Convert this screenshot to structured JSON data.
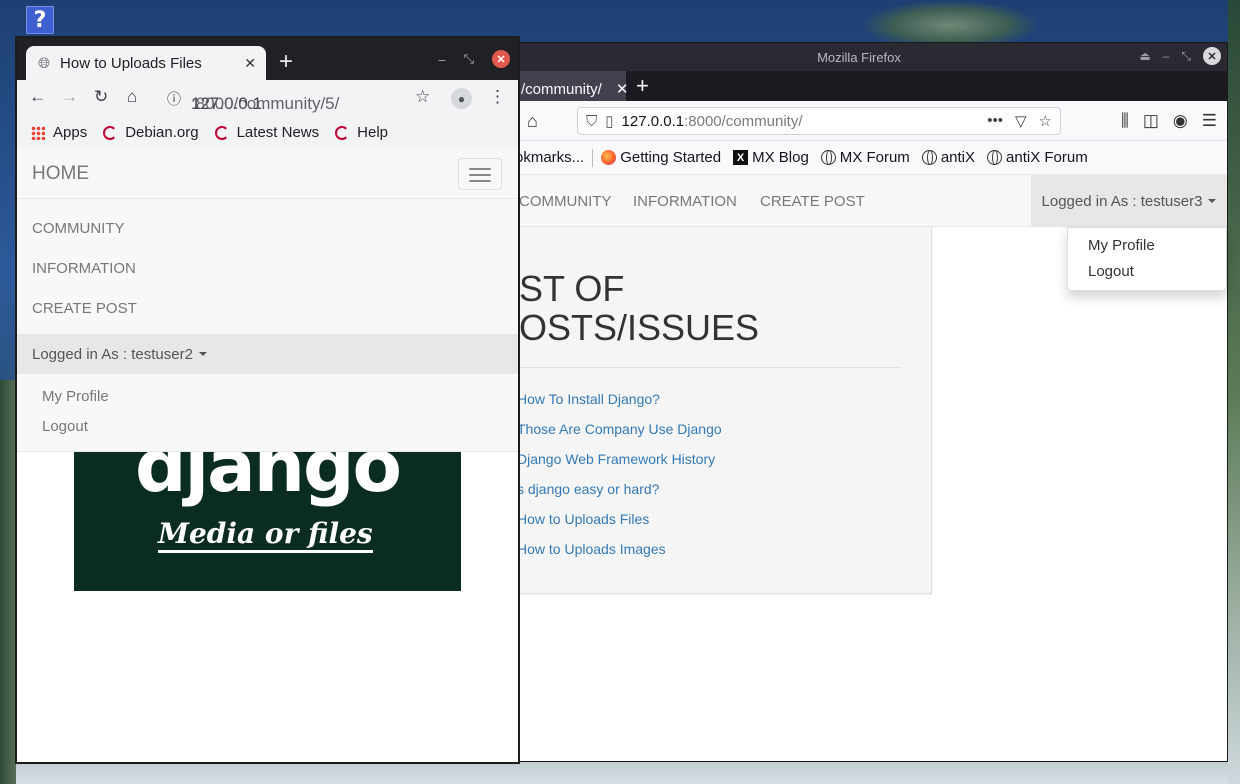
{
  "desktop": {
    "help_icon": "?"
  },
  "firefox": {
    "window_title": "Mozilla Firefox",
    "tab_title": "/community/",
    "url_host": "127.0.0.1",
    "url_rest": ":8000/community/",
    "bookmarks": {
      "other": "okmarks...",
      "items": [
        "Getting Started",
        "MX Blog",
        "MX Forum",
        "antiX",
        "antiX Forum"
      ]
    },
    "site": {
      "nav": [
        "COMMUNITY",
        "INFORMATION",
        "CREATE POST"
      ],
      "user": "Logged in As : testuser3",
      "dropdown": [
        "My Profile",
        "Logout"
      ],
      "title_line1": "ST OF",
      "title_line2": "OSTS/ISSUES",
      "posts": [
        "How To Install Django?",
        "Those Are Company Use Django",
        "Django Web Framework History",
        "s django easy or hard?",
        "How to Uploads Files",
        "How to Uploads Images"
      ]
    }
  },
  "chrome": {
    "tab_title": "How to Uploads Files",
    "url_host": "127.0.0.1",
    "url_rest": ":8000/community/5/",
    "bookmarks": [
      "Apps",
      "Debian.org",
      "Latest News",
      "Help"
    ],
    "site": {
      "brand": "HOME",
      "nav": [
        "COMMUNITY",
        "INFORMATION",
        "CREATE POST"
      ],
      "user": "Logged in As : testuser2",
      "dropdown": [
        "My Profile",
        "Logout"
      ],
      "hero_word": "django",
      "hero_caption": "Media or files"
    }
  }
}
